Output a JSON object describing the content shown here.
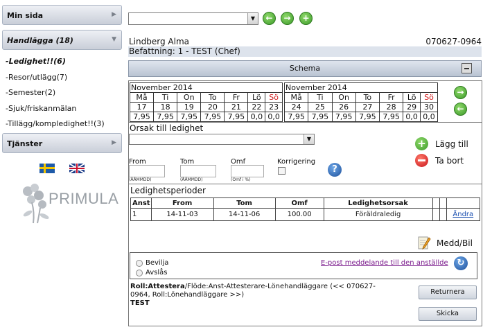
{
  "sidebar": {
    "min_sida": "Min sida",
    "handlagga": "Handlägga (18)",
    "items": [
      {
        "label": "-Ledighet!!(6)"
      },
      {
        "label": "-Resor/utlägg(7)"
      },
      {
        "label": "-Semester(2)"
      },
      {
        "label": "-Sjuk/friskanmälan"
      },
      {
        "label": "-Tillägg/kompledighet!!(3)"
      }
    ],
    "tjanster": "Tjänster",
    "logo_text": "PRIMULA",
    "flags": [
      "swedish-flag",
      "uk-flag"
    ]
  },
  "employee": {
    "name": "Lindberg Alma",
    "pnr": "070627-0964",
    "befattning": "Befattning: 1 - TEST (Chef)"
  },
  "schema": {
    "title": "Schema",
    "weeks": [
      {
        "month": "November 2014",
        "days": [
          "Må",
          "Ti",
          "On",
          "To",
          "Fr",
          "Lö",
          "Sö"
        ],
        "dates": [
          "17",
          "18",
          "19",
          "20",
          "21",
          "22",
          "23"
        ],
        "hours": [
          "7,95",
          "7,95",
          "7,95",
          "7,95",
          "7,95",
          "0,0",
          "0,0"
        ]
      },
      {
        "month": "November 2014",
        "days": [
          "Må",
          "Ti",
          "On",
          "To",
          "Fr",
          "Lö",
          "Sö"
        ],
        "dates": [
          "24",
          "25",
          "26",
          "27",
          "28",
          "29",
          "30"
        ],
        "hours": [
          "7,95",
          "7,95",
          "7,95",
          "7,95",
          "7,95",
          "0,0",
          "0,0"
        ]
      }
    ]
  },
  "orsak": {
    "title": "Orsak till ledighet",
    "from_label": "From",
    "from_hint": "(ÅÅMMDD)",
    "tom_label": "Tom",
    "tom_hint": "(ÅÅMMDD)",
    "omf_label": "Omf",
    "omf_hint": "(Omf i %)",
    "korr_label": "Korrigering",
    "add_label": "Lägg till",
    "remove_label": "Ta bort"
  },
  "perioder": {
    "title": "Ledighetsperioder",
    "headers": [
      "Anst",
      "From",
      "Tom",
      "Omf",
      "Ledighetsorsak"
    ],
    "rows": [
      {
        "anst": "1",
        "from": "14-11-03",
        "tom": "14-11-06",
        "omf": "100.00",
        "orsak": "Föräldraledig",
        "action": "Ändra"
      }
    ]
  },
  "medd_label": "Medd/Bil",
  "decision": {
    "bevilja": "Bevilja",
    "avsla": "Avslås",
    "email_link": "E-post meddelande till den anställde"
  },
  "roll": {
    "line1_bold": "Roll:Attestera",
    "line1_rest": "/Flöde:Anst-Attesterare-Lönehandläggare (<< 070627-0964, Roll:Lönehandläggare >>)",
    "line2": "TEST"
  },
  "buttons": {
    "returnera": "Returnera",
    "skicka": "Skicka"
  }
}
